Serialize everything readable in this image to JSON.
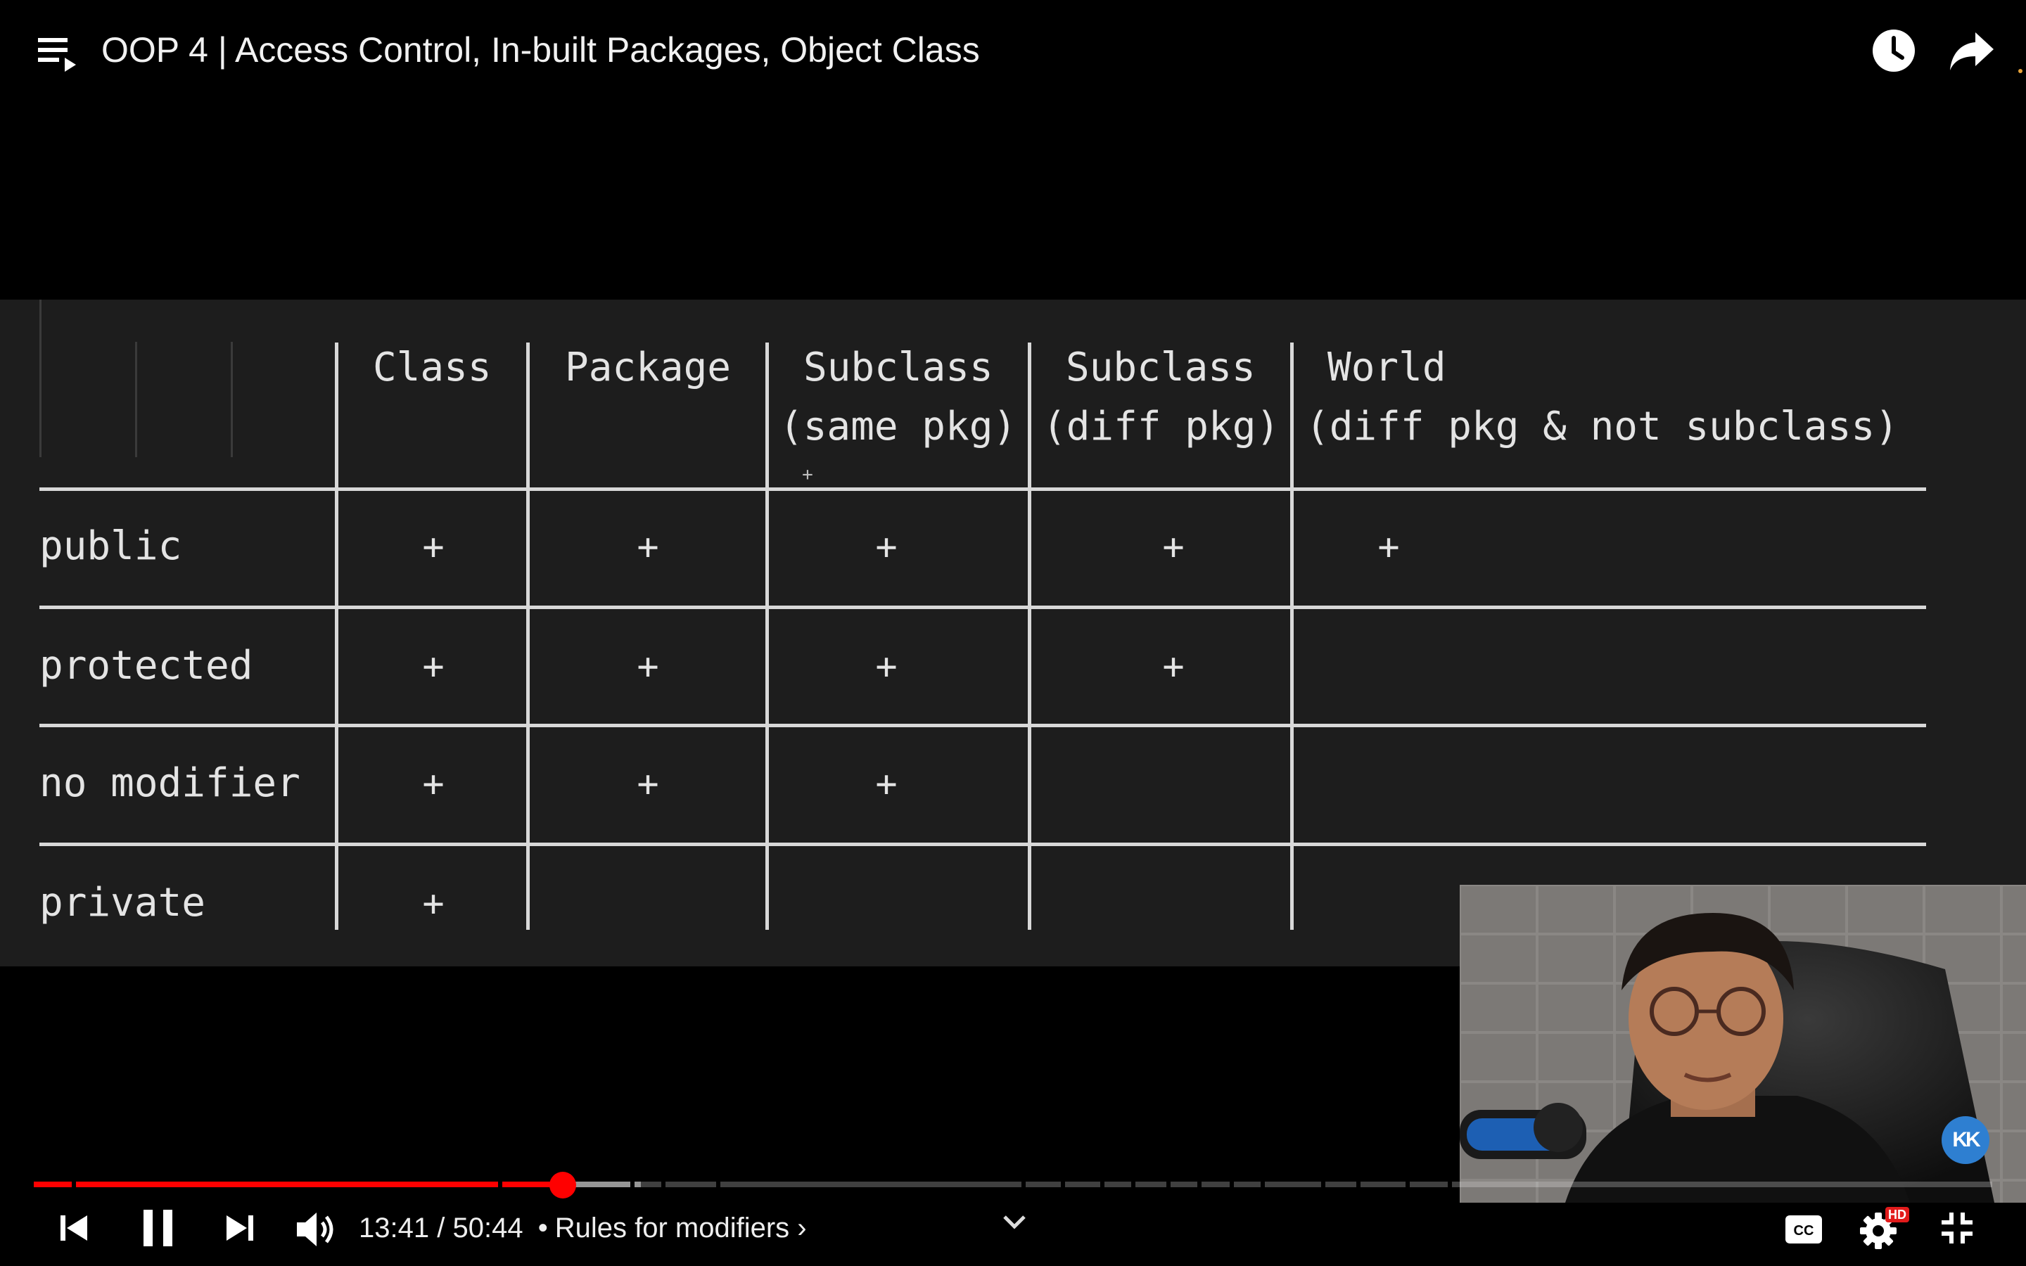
{
  "header": {
    "title": "OOP 4 | Access Control, In-built Packages, Object Class",
    "icons": [
      "playlist-icon",
      "watch-later-icon",
      "share-icon"
    ]
  },
  "slide": {
    "columns": [
      {
        "line1": "Class",
        "line2": ""
      },
      {
        "line1": "Package",
        "line2": ""
      },
      {
        "line1": "Subclass",
        "line2": "(same pkg)"
      },
      {
        "line1": "Subclass",
        "line2": "(diff pkg)"
      },
      {
        "line1": "World",
        "line2": "(diff pkg & not subclass)"
      }
    ],
    "rows": [
      {
        "label": "public",
        "cells": [
          "+",
          "+",
          "+",
          "+",
          "+"
        ]
      },
      {
        "label": "protected",
        "cells": [
          "+",
          "+",
          "+",
          "+",
          ""
        ]
      },
      {
        "label": "no modifier",
        "cells": [
          "+",
          "+",
          "+",
          "",
          ""
        ]
      },
      {
        "label": "private",
        "cells": [
          "+",
          "",
          "",
          "",
          ""
        ]
      }
    ],
    "stray_mark": "+"
  },
  "webcam": {
    "badge": "KK"
  },
  "player": {
    "progress_fraction": 0.27,
    "buffered_fraction": 0.31,
    "current_time": "13:41",
    "duration": "50:44",
    "separator": "/",
    "chapter_separator": "•",
    "chapter": "Rules for modifiers ›",
    "hd_badge": "HD",
    "cc_label": "CC",
    "colors": {
      "accent": "#ff0000",
      "slide_bg": "#1d1d1d",
      "badge": "#2e7fd1"
    }
  }
}
